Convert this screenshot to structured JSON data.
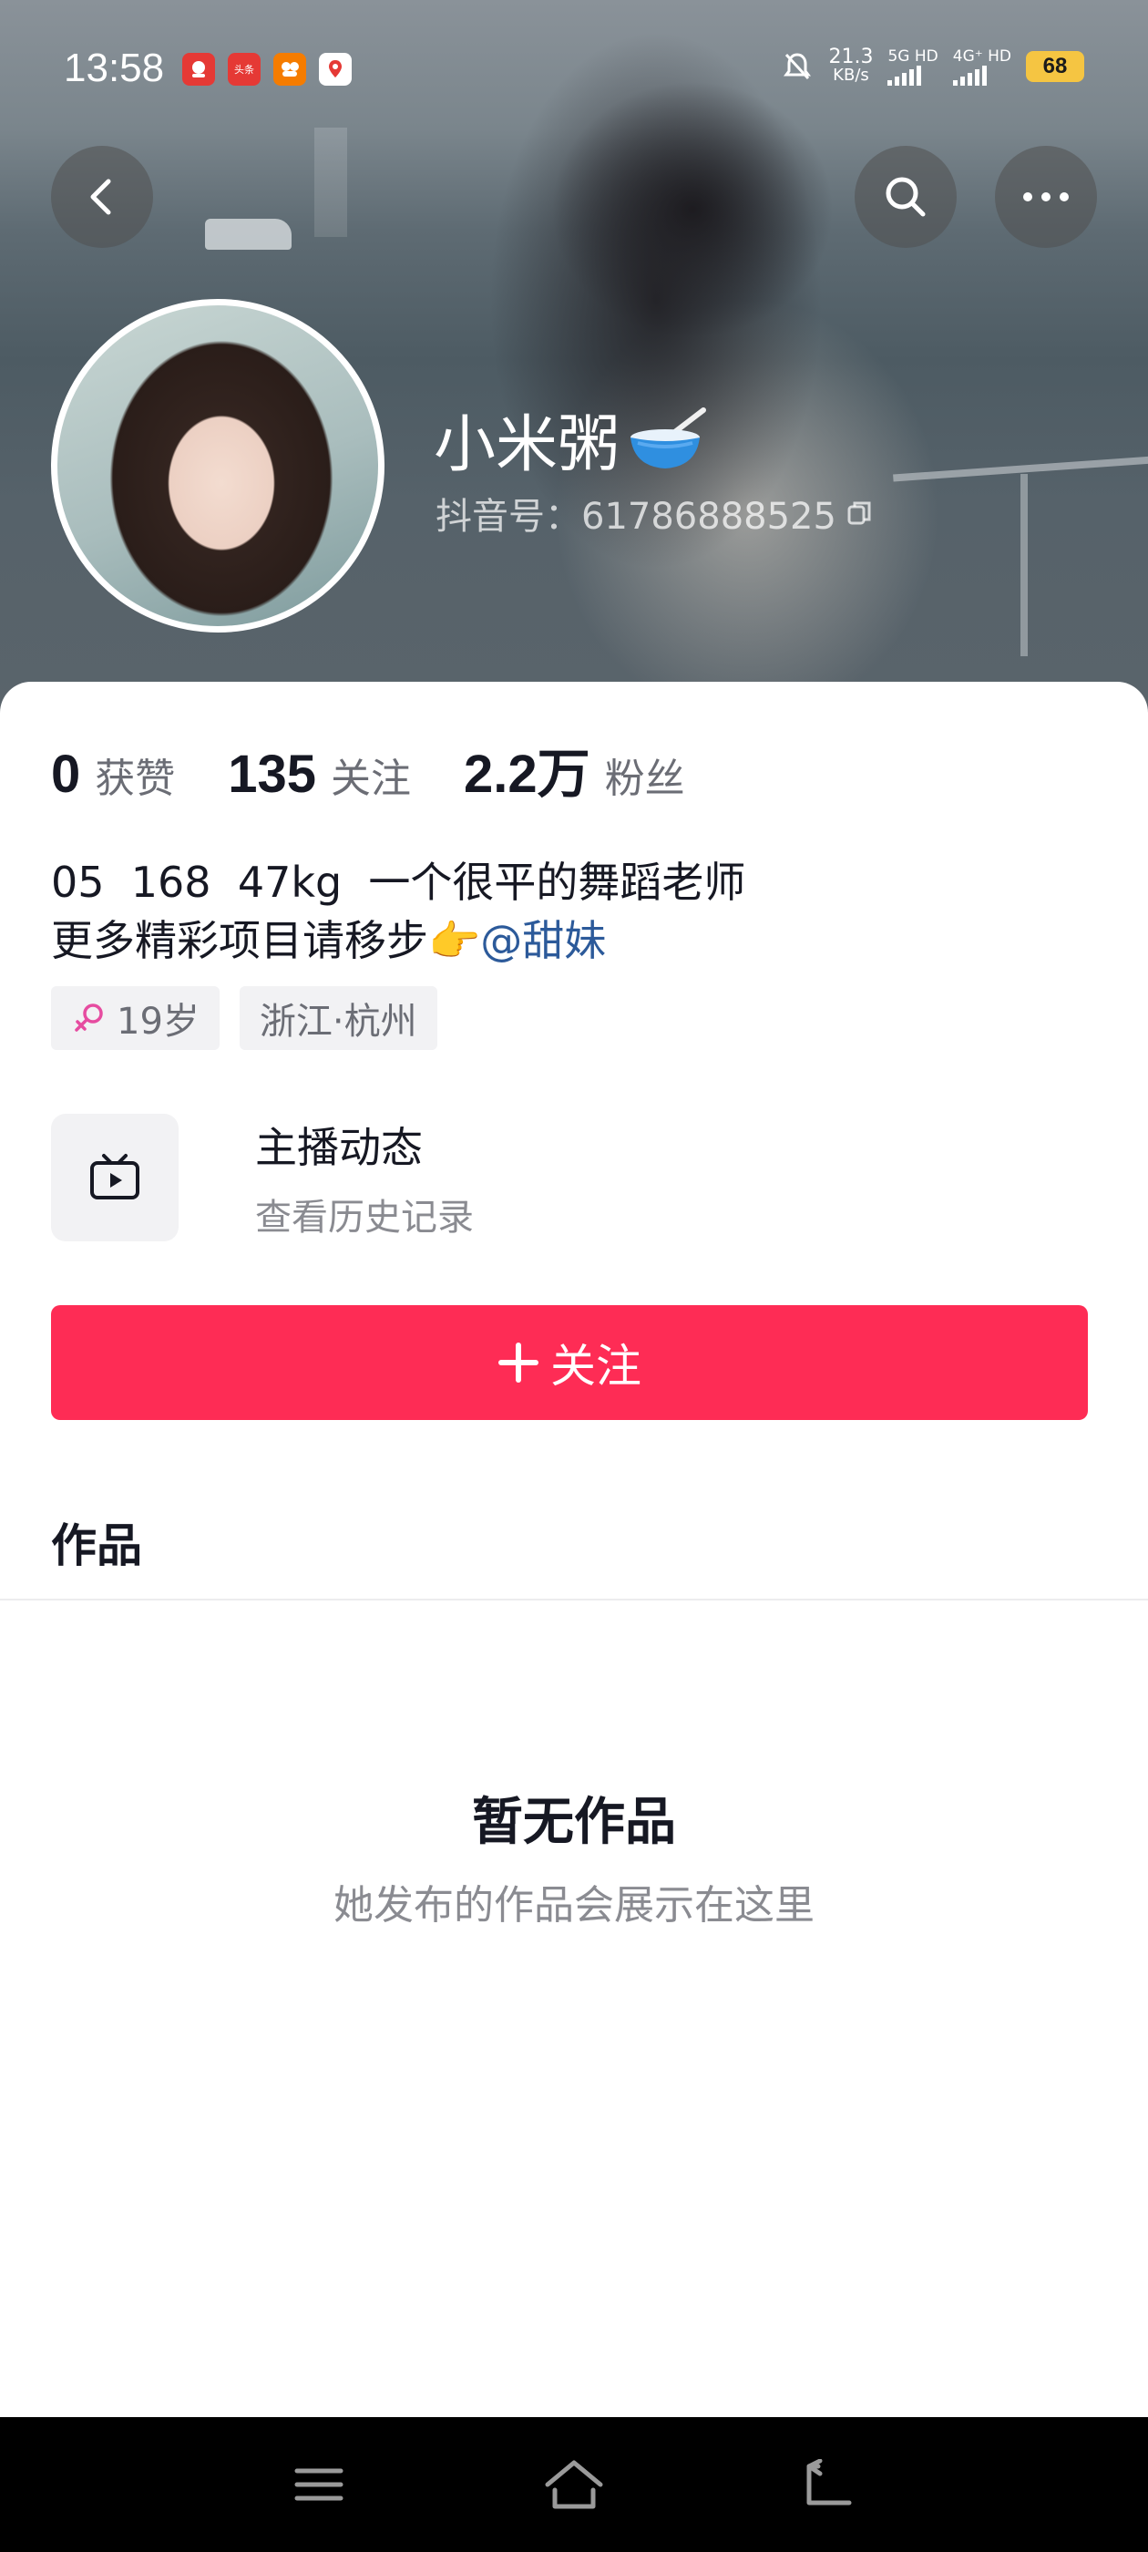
{
  "status_bar": {
    "time": "13:58",
    "apps": [
      {
        "icon": "red-app-icon",
        "color": "#e53935",
        "text": ""
      },
      {
        "icon": "toutiao-icon",
        "color": "#e53935",
        "text": "头条"
      },
      {
        "icon": "orange-app-icon",
        "color": "#f57c00",
        "text": ""
      },
      {
        "icon": "maps-icon",
        "color": "#ffffff",
        "text": ""
      }
    ],
    "net_speed_value": "21.3",
    "net_speed_unit": "KB/s",
    "sim1": "5G HD",
    "sim2": "4G⁺ HD",
    "battery": "68"
  },
  "profile": {
    "name": "小米粥",
    "douyin_id": "抖音号：61786888525",
    "stats": [
      {
        "value": "0",
        "label": "获赞"
      },
      {
        "value": "135",
        "label": "关注"
      },
      {
        "value": "2.2万",
        "label": "粉丝"
      }
    ],
    "bio_line1": "05  168  47kg  一个很平的舞蹈老师",
    "bio_line2_prefix": "更多精彩项目请移步👉",
    "bio_mention": "@甜妹",
    "tags": {
      "age": "19岁",
      "location": "浙江·杭州"
    },
    "live_card": {
      "title": "主播动态",
      "subtitle": "查看历史记录"
    },
    "follow_label": "关注",
    "works_tab": "作品",
    "empty_title": "暂无作品",
    "empty_subtitle": "她发布的作品会展示在这里"
  },
  "colors": {
    "accent": "#fe2c55",
    "mention": "#2c5a9a",
    "female": "#e64ca0",
    "battery": "#f5c542"
  }
}
